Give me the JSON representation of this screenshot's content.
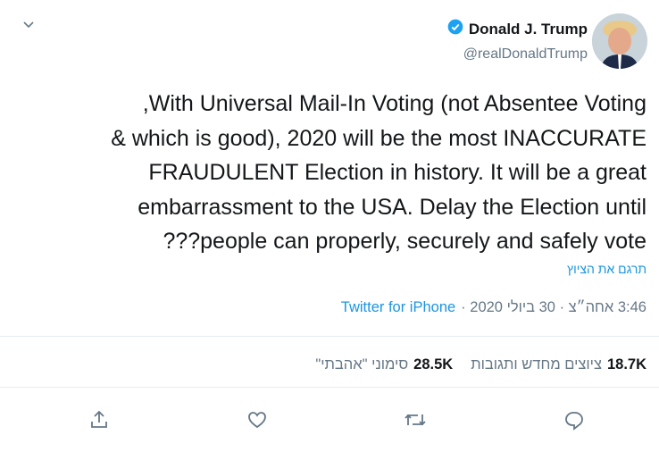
{
  "header": {
    "display_name": "Donald J. Trump",
    "handle": "@realDonaldTrump",
    "verified": true,
    "verified_color": "#1da1f2"
  },
  "tweet": {
    "lines": [
      "With Universal Mail-In Voting (not Absentee Voting,",
      "which is good), 2020 will be the most INACCURATE &",
      "FRAUDULENT Election in history. It will be a great",
      "embarrassment to the USA. Delay the Election until",
      "people can properly, securely and safely vote???"
    ],
    "translate_label": "תרגם את הציוץ"
  },
  "meta": {
    "time": "3:46 אחה״צ",
    "date": "30 ביולי 2020",
    "source": "Twitter for iPhone"
  },
  "stats": {
    "retweets_count": "18.7K",
    "retweets_label": "ציוצים מחדש ותגובות",
    "likes_count": "28.5K",
    "likes_label": "סימוני \"אהבתי\""
  },
  "actions": [
    "reply-icon",
    "retweet-icon",
    "like-icon",
    "share-icon"
  ],
  "colors": {
    "link": "#1b95e0",
    "muted": "#657786",
    "text": "#14171a"
  }
}
